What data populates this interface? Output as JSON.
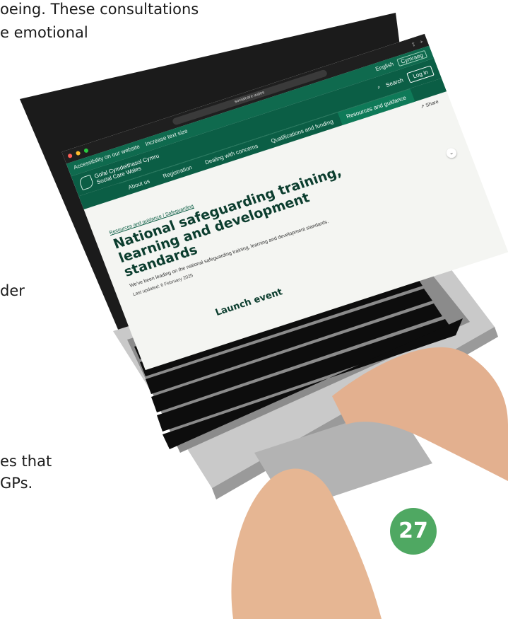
{
  "doc_fragments": {
    "line1": "oeing. These consultations",
    "line2": "e emotional",
    "line3": "der",
    "line4": "es that",
    "line5": "GPs."
  },
  "page_number": "27",
  "browser": {
    "url": "socialcare.wales",
    "traffic_lights": [
      "#ff5f57",
      "#febc2e",
      "#28c840"
    ]
  },
  "site": {
    "utility_left": "Accessibility on our website",
    "utility_text_size": "Increase text size",
    "lang_en": "English",
    "lang_cy": "Cymraeg",
    "logo_line1": "Gofal Cymdeithasol Cymru",
    "logo_line2": "Social Care Wales",
    "search_label": "Search",
    "login_label": "Log in",
    "nav": [
      {
        "label": "About us"
      },
      {
        "label": "Registration"
      },
      {
        "label": "Dealing with concerns"
      },
      {
        "label": "Qualifications and funding"
      },
      {
        "label": "Resources and guidance"
      }
    ],
    "share_label": "Share",
    "breadcrumb": "Resources and guidance / Safeguarding",
    "title": "National safeguarding training, learning and development standards",
    "summary": "We've been leading on the national safeguarding training, learning and development standards.",
    "updated": "Last updated: 6 February 2025",
    "section_heading": "Launch event"
  },
  "colors": {
    "brand_green": "#0b5e45",
    "accent_green": "#4fa862"
  }
}
